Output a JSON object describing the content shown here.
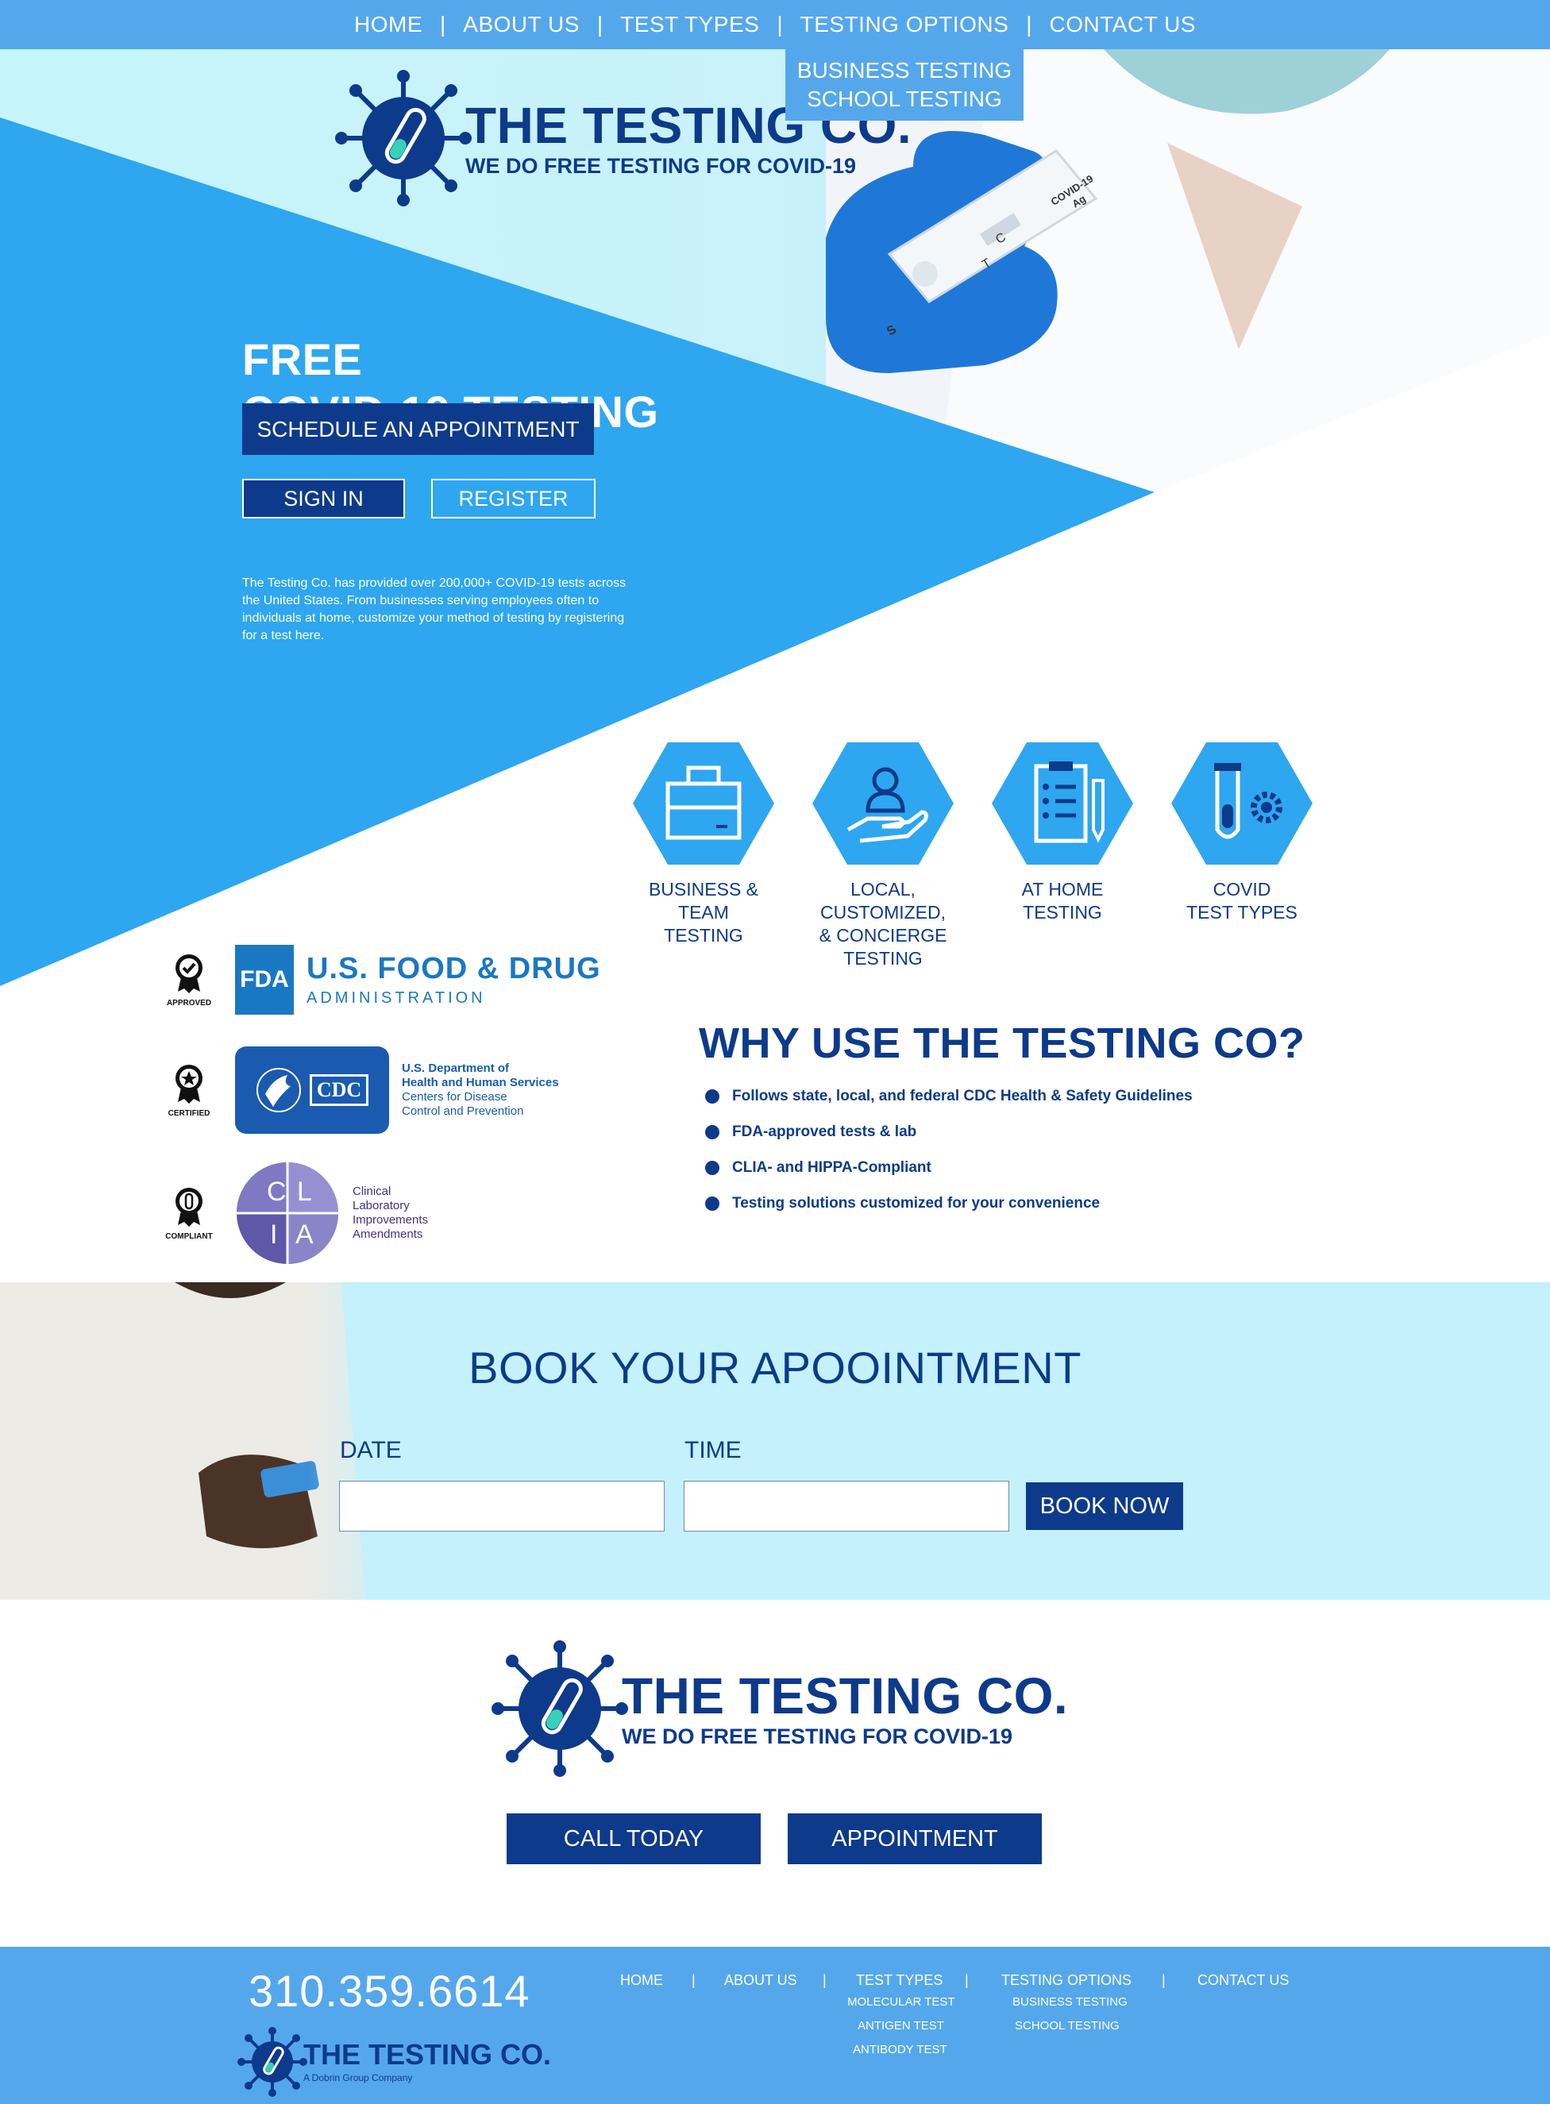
{
  "nav": {
    "items": [
      "HOME",
      "ABOUT US",
      "TEST TYPES",
      "TESTING OPTIONS",
      "CONTACT US"
    ],
    "separator": "|",
    "dropdown": [
      "BUSINESS TESTING",
      "SCHOOL TESTING"
    ]
  },
  "brand": {
    "name": "THE TESTING CO.",
    "tagline": "WE DO FREE TESTING FOR COVID-19",
    "footer_tagline": "A Dobrin Group Company"
  },
  "hero": {
    "title_line1": "FREE",
    "title_line2": "COVID-19 TESTING",
    "schedule_label": "SCHEDULE AN APPOINTMENT",
    "signin_label": "SIGN IN",
    "register_label": "REGISTER",
    "copy": "The Testing Co. has provided over 200,000+ COVID-19 tests across the United States. From businesses serving employees often to individuals at home, customize your method of testing by registering for a test here.",
    "test_kit_text": [
      "C",
      "T",
      "S",
      "COVID-19",
      "Ag"
    ]
  },
  "services": [
    {
      "label": "BUSINESS &\nTEAM\nTESTING",
      "icon": "briefcase-icon"
    },
    {
      "label": "LOCAL,\nCUSTOMIZED,\n& CONCIERGE\nTESTING",
      "icon": "hand-person-icon"
    },
    {
      "label": "AT HOME\nTESTING",
      "icon": "clipboard-icon"
    },
    {
      "label": "COVID\nTEST TYPES",
      "icon": "test-tube-gear-icon"
    }
  ],
  "credentials": {
    "badges": [
      "APPROVED",
      "CERTIFIED",
      "COMPLIANT"
    ],
    "fda": {
      "mark": "FDA",
      "line1": "U.S. FOOD & DRUG",
      "line2": "ADMINISTRATION"
    },
    "cdc": {
      "mark": "CDC",
      "line1": "U.S. Department of",
      "line2": "Health and Human Services",
      "line3": "Centers for Disease",
      "line4": "Control and Prevention"
    },
    "clia": {
      "letters": [
        "C",
        "L",
        "I",
        "A"
      ],
      "line1": "Clinical",
      "line2": "Laboratory",
      "line3": "Improvements",
      "line4": "Amendments"
    }
  },
  "why": {
    "title": "WHY USE THE TESTING CO?",
    "bullets": [
      "Follows state, local, and federal CDC Health & Safety Guidelines",
      "FDA-approved tests & lab",
      "CLIA- and HIPPA-Compliant",
      "Testing solutions customized for your convenience"
    ]
  },
  "booking": {
    "title": "BOOK YOUR APOOINTMENT",
    "date_label": "DATE",
    "time_label": "TIME",
    "date_value": "",
    "time_value": "",
    "book_label": "BOOK NOW"
  },
  "cta": {
    "call_label": "CALL TODAY",
    "appointment_label": "APPOINTMENT"
  },
  "footer": {
    "phone": "310.359.6614",
    "nav": [
      "HOME",
      "ABOUT US",
      "TEST TYPES",
      "TESTING OPTIONS",
      "CONTACT US"
    ],
    "test_types_sub": [
      "MOLECULAR TEST",
      "ANTIGEN TEST",
      "ANTIBODY TEST"
    ],
    "testing_options_sub": [
      "BUSINESS TESTING",
      "SCHOOL TESTING"
    ]
  },
  "colors": {
    "navy": "#0d3a8a",
    "sky_blue": "#2ea6f0",
    "nav_blue": "#55a7ec",
    "pale_cyan": "#c4f1fb"
  }
}
